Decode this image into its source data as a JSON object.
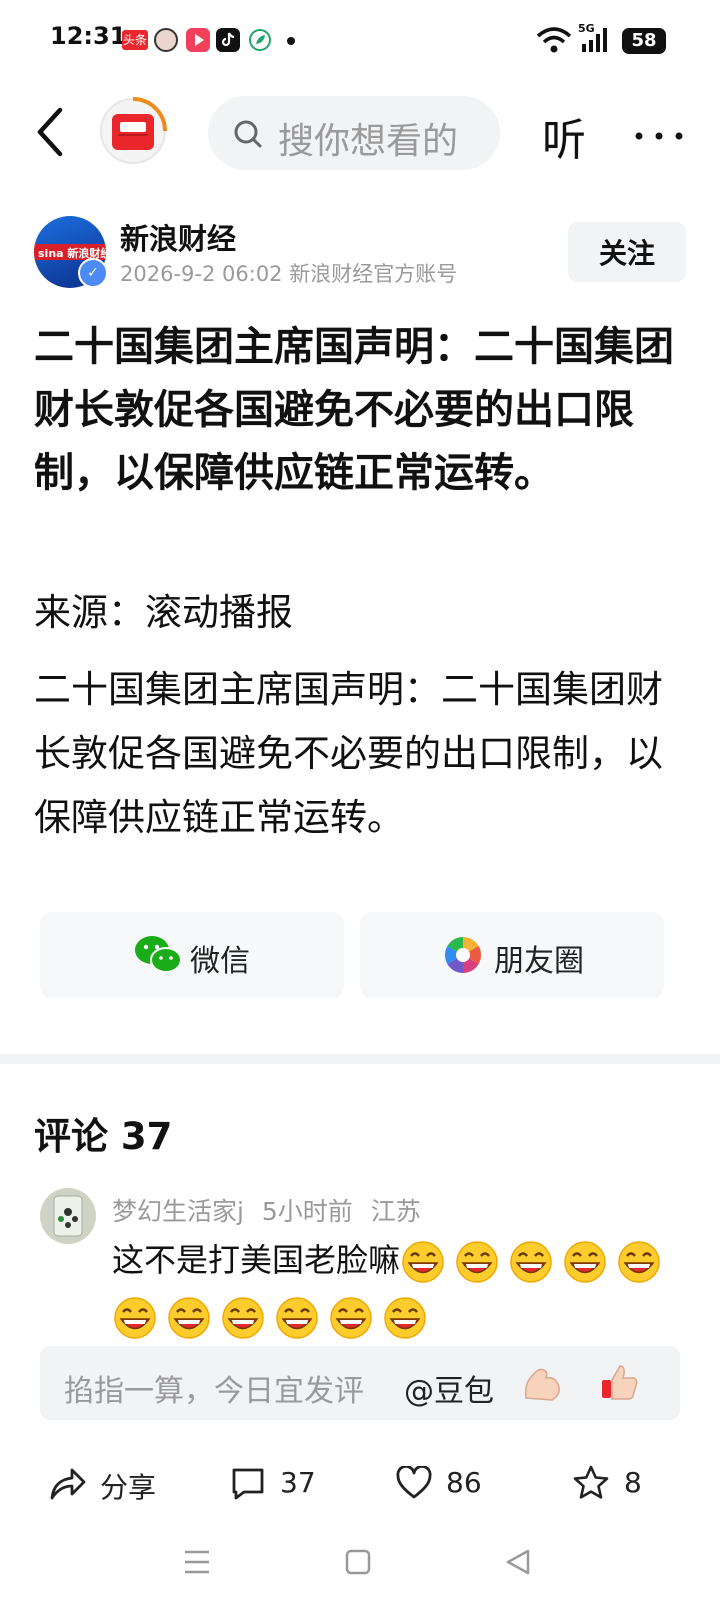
{
  "status_bar": {
    "time": "12:31",
    "app_badge": "头条",
    "signal_label": "5G",
    "battery": "58"
  },
  "top_bar": {
    "search_placeholder": "搜你想看的",
    "listen_label": "听"
  },
  "author": {
    "name": "新浪财经",
    "date": "2026-9-2",
    "time": "06:02",
    "account_type": "新浪财经官方账号",
    "follow_label": "关注",
    "avatar_logo_text": "sina 新浪财经"
  },
  "article": {
    "title": "二十国集团主席国声明：二十国集团财长敦促各国避免不必要的出口限制，以保障供应链正常运转。",
    "source": "来源：滚动播报",
    "body": "二十国集团主席国声明：二十国集团财长敦促各国避免不必要的出口限制，以保障供应链正常运转。"
  },
  "share": {
    "wechat_label": "微信",
    "moments_label": "朋友圈"
  },
  "comments": {
    "title": "评论 37",
    "items": [
      {
        "user": "梦幻生活家j",
        "time": "5小时前",
        "location": "江苏",
        "text": "这不是打美国老脸嘛",
        "emoji": "laughing-emoji",
        "emoji_count": 11
      }
    ]
  },
  "input": {
    "placeholder": "掐指一算，今日宜发评",
    "mention": "@豆包"
  },
  "actions": {
    "share_label": "分享",
    "comment_count": "37",
    "like_count": "86",
    "favorite_count": "8"
  },
  "colors": {
    "accent_red": "#e8262b",
    "wechat_green": "#1aad19",
    "muted_gray": "#9a9a9a",
    "surface_gray": "#f2f3f5"
  }
}
